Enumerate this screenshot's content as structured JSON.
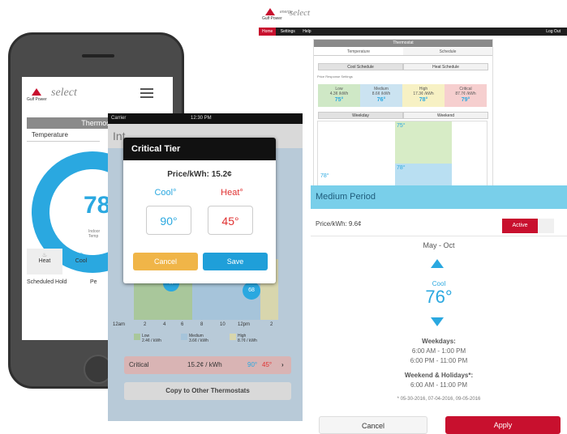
{
  "web": {
    "logo_brand": "Gulf Power",
    "logo_sub": "energy",
    "logo_product": "select",
    "nav": {
      "home": "Home",
      "settings": "Settings",
      "help": "Help",
      "logout": "Log Out"
    },
    "panel_title": "Thermostat",
    "tab_temperature": "Temperature",
    "tab_schedule": "Schedule",
    "cool_schedule": "Cool Schedule",
    "heat_schedule": "Heat Schedule",
    "price_settings": "Price Response Settings",
    "tiers": [
      {
        "name": "Low",
        "price": "4.3¢ /kWh",
        "temp": "75°",
        "color": "#cfe8c6"
      },
      {
        "name": "Medium",
        "price": "8.6¢ /kWh",
        "temp": "76°",
        "color": "#cbe3f1"
      },
      {
        "name": "High",
        "price": "17.3¢ /kWh",
        "temp": "78°",
        "color": "#f7f1c4"
      },
      {
        "name": "Critical",
        "price": "87.7¢ /kWh",
        "temp": "79°",
        "color": "#f6cfcf"
      }
    ],
    "weekday": "Weekday",
    "weekend": "Weekend",
    "chart_labels": {
      "low_temp": "75°",
      "high_temp": "78°",
      "high2": "78°"
    },
    "medium_period_title": "Medium Period",
    "price_label": "Price/kWh: 9.6¢",
    "active_label": "Active",
    "season": "May - Oct",
    "cool_label": "Cool",
    "cool_temp": "76°",
    "weekdays_title": "Weekdays:",
    "weekdays_time1": "6:00 AM - 1:00 PM",
    "weekdays_time2": "6:00 PM - 11:00 PM",
    "weekend_title": "Weekend & Holidays*:",
    "weekend_time": "6:00 AM - 11:00 PM",
    "holidays_note": "* 05-30-2016,  07-04-2016,  09-05-2016",
    "cancel": "Cancel",
    "apply": "Apply"
  },
  "phone": {
    "brand": "Gulf Power",
    "product": "select",
    "title": "Thermostat",
    "tab_temperature": "Temperature",
    "temp": "78",
    "indoor_label": "Indoor Temp",
    "indoor_temp": "78",
    "heat": "Heat",
    "cool": "Cool",
    "scheduled_hold": "Scheduled Hold",
    "pe": "Pe"
  },
  "tablet": {
    "carrier": "Carrier",
    "time": "12:30 PM",
    "title_partial": "Int",
    "dialog_title": "Critical Tier",
    "price": "Price/kWh: 15.2¢",
    "cool": "Cool°",
    "heat": "Heat°",
    "cool_value": "90°",
    "heat_value": "45°",
    "cancel": "Cancel",
    "save": "Save",
    "x_ticks": [
      "12am",
      "2",
      "4",
      "6",
      "8",
      "10",
      "12pm",
      "2"
    ],
    "legend_low": "Low",
    "legend_low_price": "2.4¢ / kWh",
    "legend_medium": "Medium",
    "legend_medium_price": "3.6¢ / kWh",
    "legend_high": "High",
    "legend_high_price": "8.7¢ / kWh",
    "critical_label": "Critical",
    "critical_value": "15.2¢ / kWh",
    "critical_cool": "90°",
    "critical_heat": "45°",
    "copy_label": "Copy to Other Thermostats",
    "bubble_left": "X",
    "bubble_right": "68"
  }
}
